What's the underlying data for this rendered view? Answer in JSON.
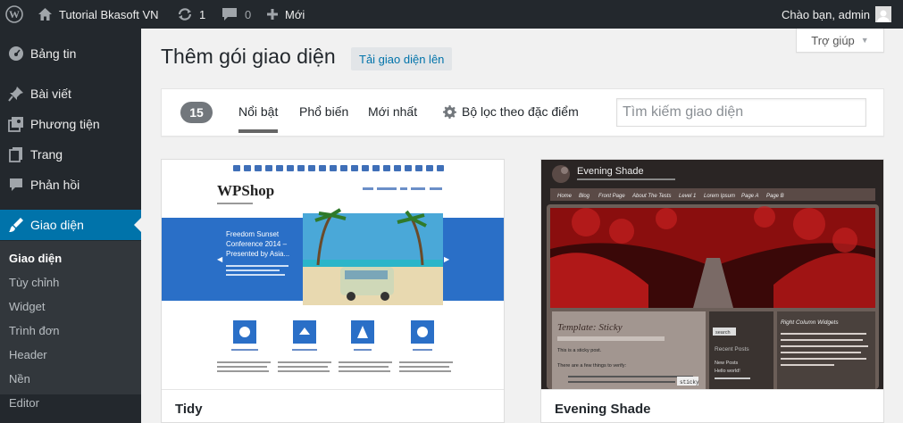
{
  "adminbar": {
    "site_name": "Tutorial Bkasoft VN",
    "updates_count": "1",
    "comments_count": "0",
    "new_label": "Mới",
    "greeting": "Chào bạn, admin"
  },
  "sidebar": {
    "items": [
      {
        "label": "Bảng tin",
        "icon": "dashboard-icon"
      },
      {
        "label": "Bài viết",
        "icon": "pin-icon"
      },
      {
        "label": "Phương tiện",
        "icon": "media-icon"
      },
      {
        "label": "Trang",
        "icon": "pages-icon"
      },
      {
        "label": "Phản hồi",
        "icon": "comments-icon"
      },
      {
        "label": "Giao diện",
        "icon": "appearance-icon"
      }
    ],
    "submenu": [
      "Giao diện",
      "Tùy chỉnh",
      "Widget",
      "Trình đơn",
      "Header",
      "Nền",
      "Editor"
    ]
  },
  "main": {
    "title": "Thêm gói giao diện",
    "upload_label": "Tải giao diện lên",
    "help_label": "Trợ giúp"
  },
  "filter": {
    "count": "15",
    "tabs": [
      "Nổi bật",
      "Phổ biến",
      "Mới nhất"
    ],
    "feature_filter": "Bộ lọc theo đặc điểm",
    "search_placeholder": "Tìm kiếm giao diện"
  },
  "themes": [
    {
      "name": "Tidy",
      "preview": {
        "logo": "WPShop",
        "slide_title": "Freedom Sunset Conference 2014 – Presented by Asia..."
      }
    },
    {
      "name": "Evening Shade",
      "preview": {
        "site_title": "Evening Shade",
        "nav": [
          "Home",
          "Blog",
          "Front Page",
          "About The Tests",
          "Level 1",
          "Lorem Ipsum",
          "Page A",
          "Page B"
        ],
        "post_title": "Template: Sticky",
        "post_lines": [
          "This is a sticky post.",
          "There are a few things to verify:"
        ],
        "sidebar_heading1": "Recent Posts",
        "sidebar_heading2": "Right Column Widgets",
        "search_label": "search",
        "recent": [
          "New Posts",
          "Hello world!"
        ],
        "sticky_tag": "sticky"
      }
    }
  ],
  "colors": {
    "adminbar": "#23282d",
    "accent": "#0073aa",
    "submenu_bg": "#32373c"
  }
}
